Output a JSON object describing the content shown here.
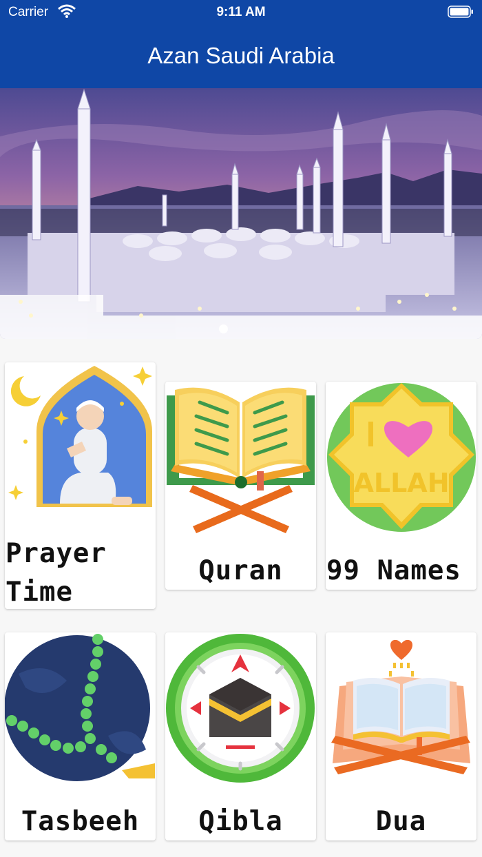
{
  "status_bar": {
    "carrier": "Carrier",
    "time": "9:11 AM"
  },
  "app": {
    "title": "Azan Saudi Arabia"
  },
  "tiles": [
    {
      "label": "Prayer Time"
    },
    {
      "label": "Quran"
    },
    {
      "label": "99 Names"
    },
    {
      "label": "Tasbeeh"
    },
    {
      "label": "Qibla"
    },
    {
      "label": "Dua"
    }
  ],
  "icon_text": {
    "allah_badge": "ALLAH",
    "allah_prefix": "I"
  },
  "colors": {
    "header": "#0f47a6",
    "background": "#f7f7f7"
  }
}
